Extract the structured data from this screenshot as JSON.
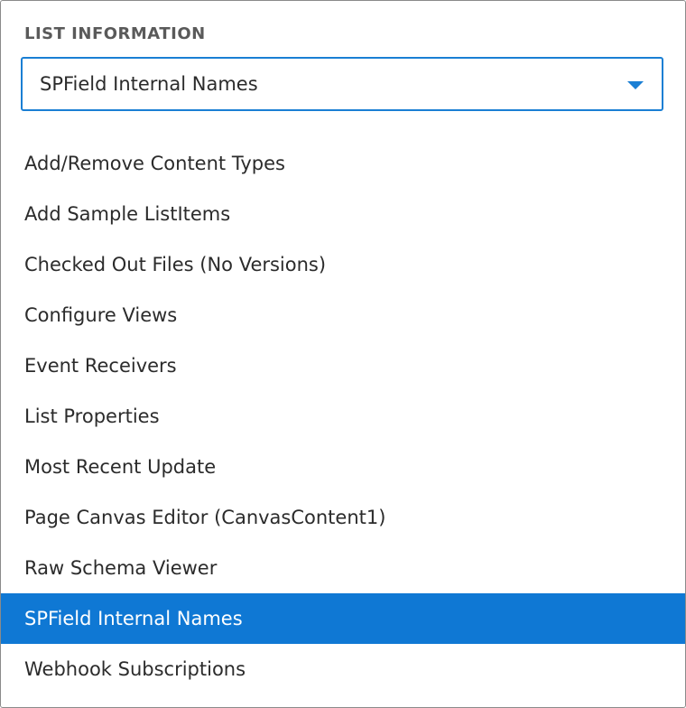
{
  "section": {
    "title": "LIST INFORMATION"
  },
  "dropdown": {
    "selected": "SPField Internal Names",
    "caret_icon": "caret-down-icon",
    "accent_color": "#1a7fd4"
  },
  "options": [
    {
      "label": "Add/Remove Content Types",
      "selected": false
    },
    {
      "label": "Add Sample ListItems",
      "selected": false
    },
    {
      "label": "Checked Out Files (No Versions)",
      "selected": false
    },
    {
      "label": "Configure Views",
      "selected": false
    },
    {
      "label": "Event Receivers",
      "selected": false
    },
    {
      "label": "List Properties",
      "selected": false
    },
    {
      "label": "Most Recent Update",
      "selected": false
    },
    {
      "label": "Page Canvas Editor (CanvasContent1)",
      "selected": false
    },
    {
      "label": "Raw Schema Viewer",
      "selected": false
    },
    {
      "label": "SPField Internal Names",
      "selected": true
    },
    {
      "label": "Webhook Subscriptions",
      "selected": false
    }
  ],
  "colors": {
    "selected_background": "#0f78d4",
    "selected_text": "#ffffff",
    "text": "#2b2b2b",
    "title": "#5a5a5a"
  }
}
